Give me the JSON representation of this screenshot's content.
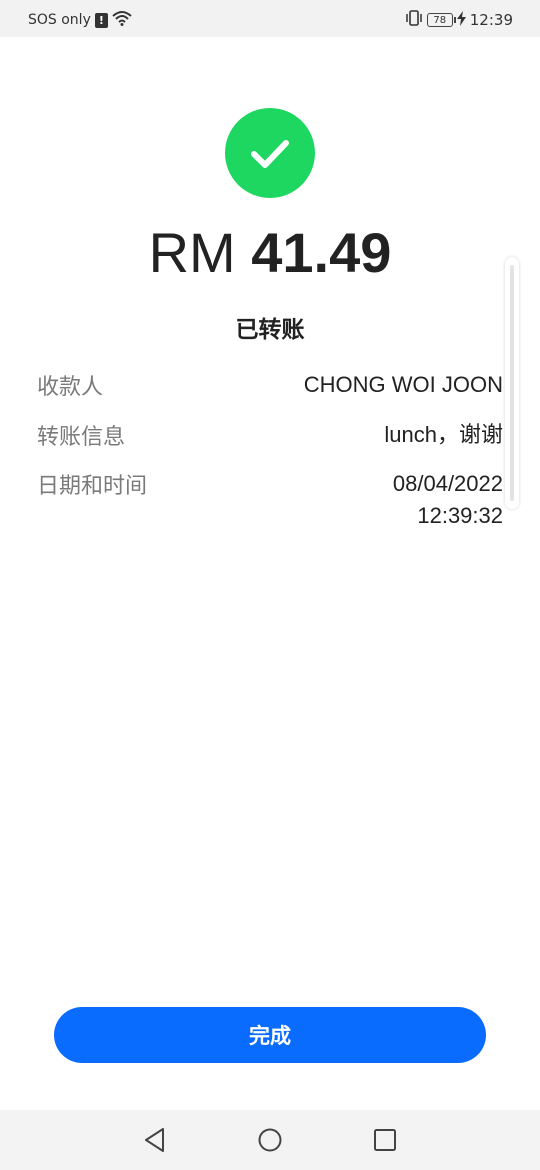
{
  "status_bar": {
    "carrier": "SOS only",
    "alert_icon": "!",
    "battery": "78",
    "time": "12:39",
    "icons": [
      "alert-icon",
      "wifi-icon",
      "vibrate-icon",
      "battery-icon",
      "charging-icon"
    ]
  },
  "receipt": {
    "currency": "RM",
    "amount": "41.49",
    "status": "已转账",
    "details": [
      {
        "label": "收款人",
        "value": "CHONG WOI JOON"
      },
      {
        "label": "转账信息",
        "value": "lunch，谢谢"
      },
      {
        "label": "日期和时间",
        "value_date": "08/04/2022",
        "value_time": "12:39:32"
      }
    ]
  },
  "actions": {
    "done_label": "完成"
  },
  "colors": {
    "success": "#1ed760",
    "primary_button": "#0a6cff",
    "label_text": "#7a7a7a",
    "value_text": "#222222"
  },
  "nav": {
    "icons": [
      "back-icon",
      "home-icon",
      "recent-apps-icon"
    ]
  }
}
